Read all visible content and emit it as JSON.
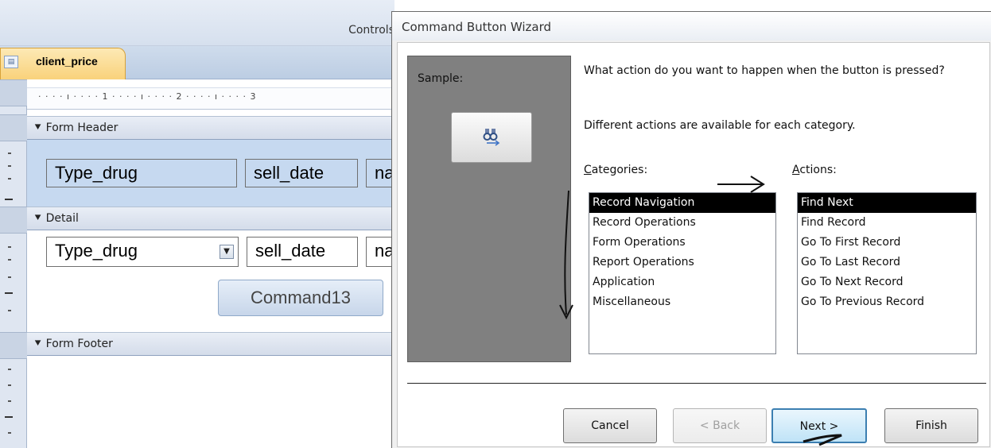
{
  "toolbar": {
    "controls_label": "Controls"
  },
  "document_tab": {
    "label": "client_price"
  },
  "ruler": {
    "marks": "· · · · ı · · · · 1 · · · · ı · · · · 2 · · · · ı · · · · 3"
  },
  "sections": {
    "form_header": {
      "label": "Form Header",
      "fields": [
        "Type_drug",
        "sell_date",
        "na"
      ]
    },
    "detail": {
      "label": "Detail",
      "fields": [
        "Type_drug",
        "sell_date",
        "na"
      ],
      "command_button": "Command13"
    },
    "form_footer": {
      "label": "Form Footer"
    }
  },
  "wizard": {
    "title": "Command Button Wizard",
    "sample_label": "Sample:",
    "question": "What action do you want to happen when the button is pressed?",
    "hint": "Different actions are available for each category.",
    "categories_label": "Categories:",
    "actions_label": "Actions:",
    "categories": [
      "Record Navigation",
      "Record Operations",
      "Form Operations",
      "Report Operations",
      "Application",
      "Miscellaneous"
    ],
    "selected_category": "Record Navigation",
    "actions": [
      "Find Next",
      "Find Record",
      "Go To First Record",
      "Go To Last Record",
      "Go To Next Record",
      "Go To Previous Record"
    ],
    "selected_action": "Find Next",
    "buttons": {
      "cancel": "Cancel",
      "back": "< Back",
      "next": "Next >",
      "finish": "Finish"
    }
  },
  "icons": {
    "section_marker": "section-arrow-icon",
    "sample": "binoculars-icon",
    "combo": "chevron-down-icon",
    "tab": "form-icon"
  },
  "colors": {
    "tab_active": "#f9d27b",
    "header_section": "#c6d9f0",
    "list_selection": "#000000",
    "sample_panel": "#808080"
  }
}
